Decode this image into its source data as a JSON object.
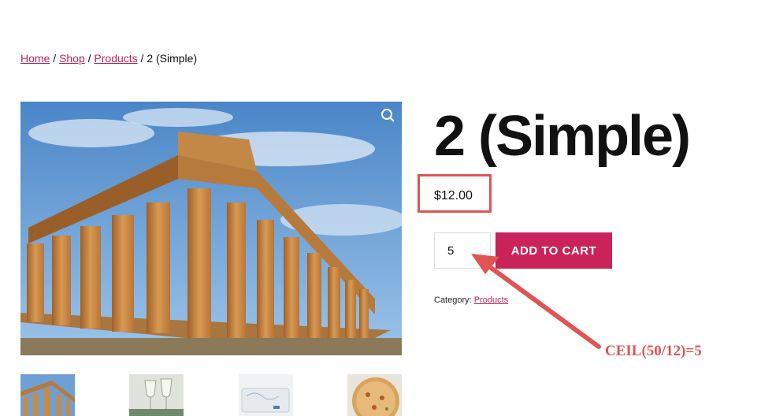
{
  "breadcrumb": {
    "home": "Home",
    "sep1": " / ",
    "shop": "Shop",
    "sep2": " / ",
    "products": "Products",
    "current": " / 2 (Simple)"
  },
  "product": {
    "title": "2 (Simple)",
    "price": "$12.00",
    "quantity": "5",
    "add_to_cart_label": "ADD TO CART",
    "category_label": "Category: ",
    "category_link": "Products"
  },
  "annotation": {
    "formula": "CEIL(50/12)=5",
    "color": "#e05454"
  },
  "colors": {
    "accent": "#c9235a",
    "link": "#c0245a"
  },
  "icons": {
    "zoom": "magnifier-icon"
  }
}
